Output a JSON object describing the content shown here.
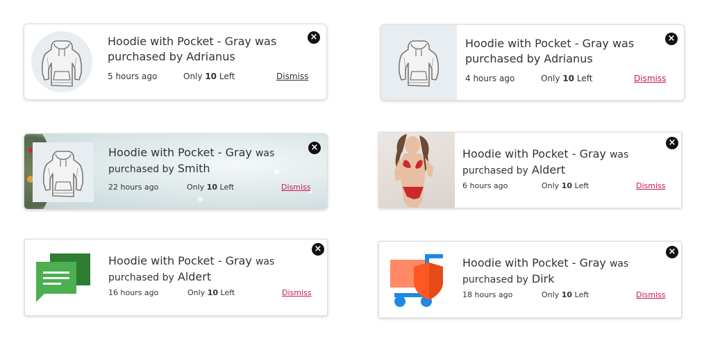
{
  "product_name": "Hoodie with Pocket - Gray",
  "purchased_by_text": "purchased by",
  "was_text": "was",
  "only_text": "Only",
  "stock_count": "10",
  "left_text": "Left",
  "dismiss_label": "Dismiss",
  "close_glyph": "×",
  "colors": {
    "dismiss_dark": "#333333",
    "dismiss_accent": "#c2185b",
    "chat_dark": "#2e7d32",
    "chat_light": "#4caf50",
    "cart_accent": "#ff5722",
    "cart_blue": "#1e88e5"
  },
  "notifications": [
    {
      "buyer": "Adrianus",
      "time": "5 hours ago",
      "image": "hoodie-sketch-icon",
      "style": "circle-image"
    },
    {
      "buyer": "Adrianus",
      "time": "4 hours ago",
      "image": "hoodie-sketch-icon",
      "style": "side-image"
    },
    {
      "buyer": "Smith",
      "time": "22 hours ago",
      "image": "hoodie-sketch-icon",
      "style": "holiday-background"
    },
    {
      "buyer": "Aldert",
      "time": "6 hours ago",
      "image": "model-photo",
      "style": "side-photo"
    },
    {
      "buyer": "Aldert",
      "time": "16 hours ago",
      "image": "chat-bubbles-icon",
      "style": "icon"
    },
    {
      "buyer": "Dirk",
      "time": "18 hours ago",
      "image": "shopping-cart-shield-icon",
      "style": "icon"
    }
  ]
}
